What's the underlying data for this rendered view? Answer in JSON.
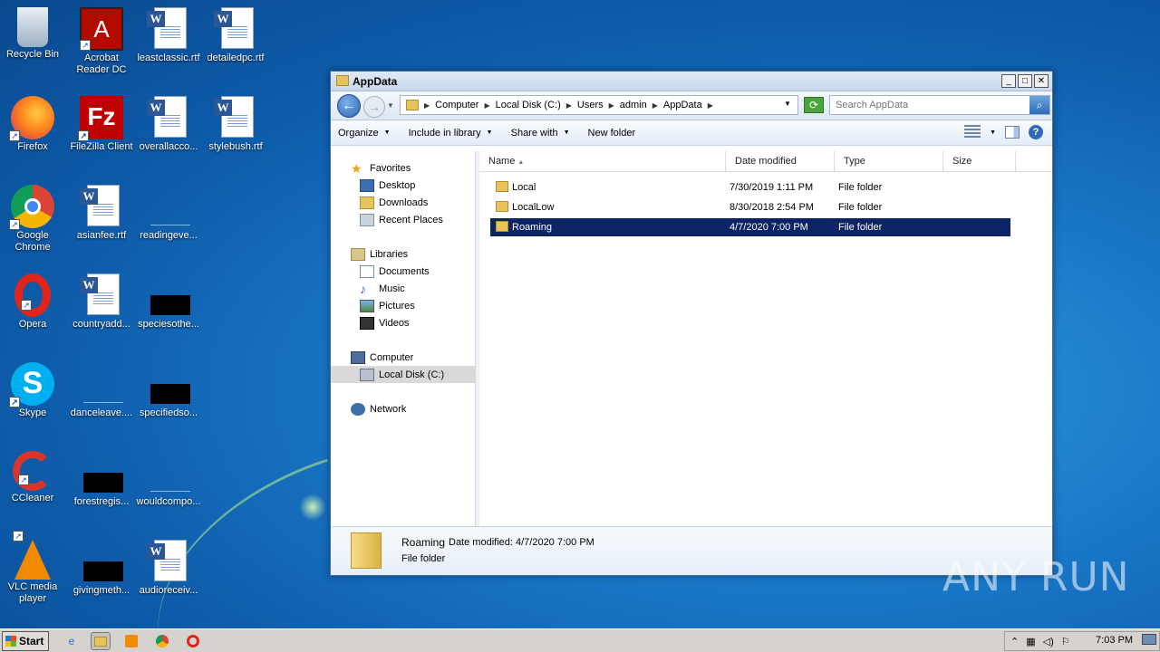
{
  "desktop": {
    "icons": [
      {
        "label": "Recycle Bin"
      },
      {
        "label": "Acrobat Reader DC"
      },
      {
        "label": "leastclassic.rtf"
      },
      {
        "label": "detailedpc.rtf"
      },
      {
        "label": "Firefox"
      },
      {
        "label": "FileZilla Client"
      },
      {
        "label": "overallacco..."
      },
      {
        "label": "stylebush.rtf"
      },
      {
        "label": "Google Chrome"
      },
      {
        "label": "asianfee.rtf"
      },
      {
        "label": "readingeve..."
      },
      {
        "label": "Opera"
      },
      {
        "label": "countryadd..."
      },
      {
        "label": "speciesothe..."
      },
      {
        "label": "Skype"
      },
      {
        "label": "danceleave...."
      },
      {
        "label": "specifiedso..."
      },
      {
        "label": "CCleaner"
      },
      {
        "label": "forestregis..."
      },
      {
        "label": "wouldcompo..."
      },
      {
        "label": "VLC media player"
      },
      {
        "label": "givingmeth..."
      },
      {
        "label": "audioreceiv..."
      }
    ]
  },
  "window": {
    "title": "AppData",
    "breadcrumb": [
      "Computer",
      "Local Disk (C:)",
      "Users",
      "admin",
      "AppData"
    ],
    "search_placeholder": "Search AppData",
    "toolbar": {
      "organize": "Organize",
      "include": "Include in library",
      "share": "Share with",
      "newfolder": "New folder"
    },
    "nav": {
      "favorites": "Favorites",
      "desktop": "Desktop",
      "downloads": "Downloads",
      "recent": "Recent Places",
      "libraries": "Libraries",
      "documents": "Documents",
      "music": "Music",
      "pictures": "Pictures",
      "videos": "Videos",
      "computer": "Computer",
      "localdisk": "Local Disk (C:)",
      "network": "Network"
    },
    "columns": {
      "name": "Name",
      "date": "Date modified",
      "type": "Type",
      "size": "Size"
    },
    "files": [
      {
        "name": "Local",
        "date": "7/30/2019 1:11 PM",
        "type": "File folder"
      },
      {
        "name": "LocalLow",
        "date": "8/30/2018 2:54 PM",
        "type": "File folder"
      },
      {
        "name": "Roaming",
        "date": "4/7/2020 7:00 PM",
        "type": "File folder"
      }
    ],
    "details": {
      "name": "Roaming",
      "modified": "Date modified: 4/7/2020 7:00 PM",
      "type": "File folder"
    }
  },
  "watermark": "ANY RUN",
  "taskbar": {
    "start": "Start",
    "clock": "7:03 PM"
  }
}
